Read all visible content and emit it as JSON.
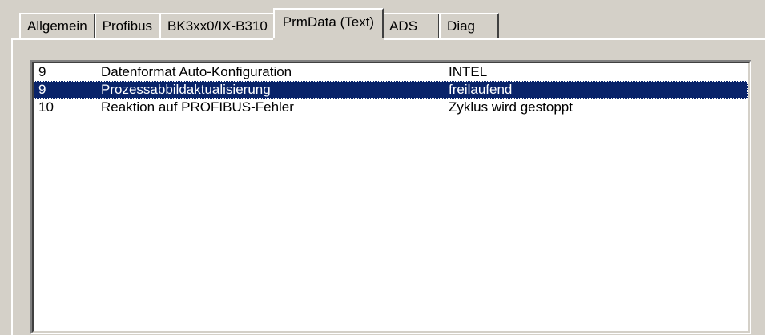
{
  "tabs": [
    {
      "label": "Allgemein",
      "active": false
    },
    {
      "label": "Profibus",
      "active": false
    },
    {
      "label": "BK3xx0/IX-B310",
      "active": false
    },
    {
      "label": "PrmData (Text)",
      "active": true
    },
    {
      "label": "ADS",
      "active": false
    },
    {
      "label": "Diag",
      "active": false
    }
  ],
  "list": {
    "rows": [
      {
        "number": "9",
        "name": "Datenformat Auto-Konfiguration",
        "value": "INTEL",
        "selected": false
      },
      {
        "number": "9",
        "name": "Prozessabbildaktualisierung",
        "value": "freilaufend",
        "selected": true
      },
      {
        "number": "10",
        "name": "Reaktion auf PROFIBUS-Fehler",
        "value": "Zyklus wird gestoppt",
        "selected": false
      }
    ]
  },
  "colors": {
    "window_face": "#d4d0c8",
    "selection": "#0a246a",
    "list_background": "#ffffff"
  }
}
